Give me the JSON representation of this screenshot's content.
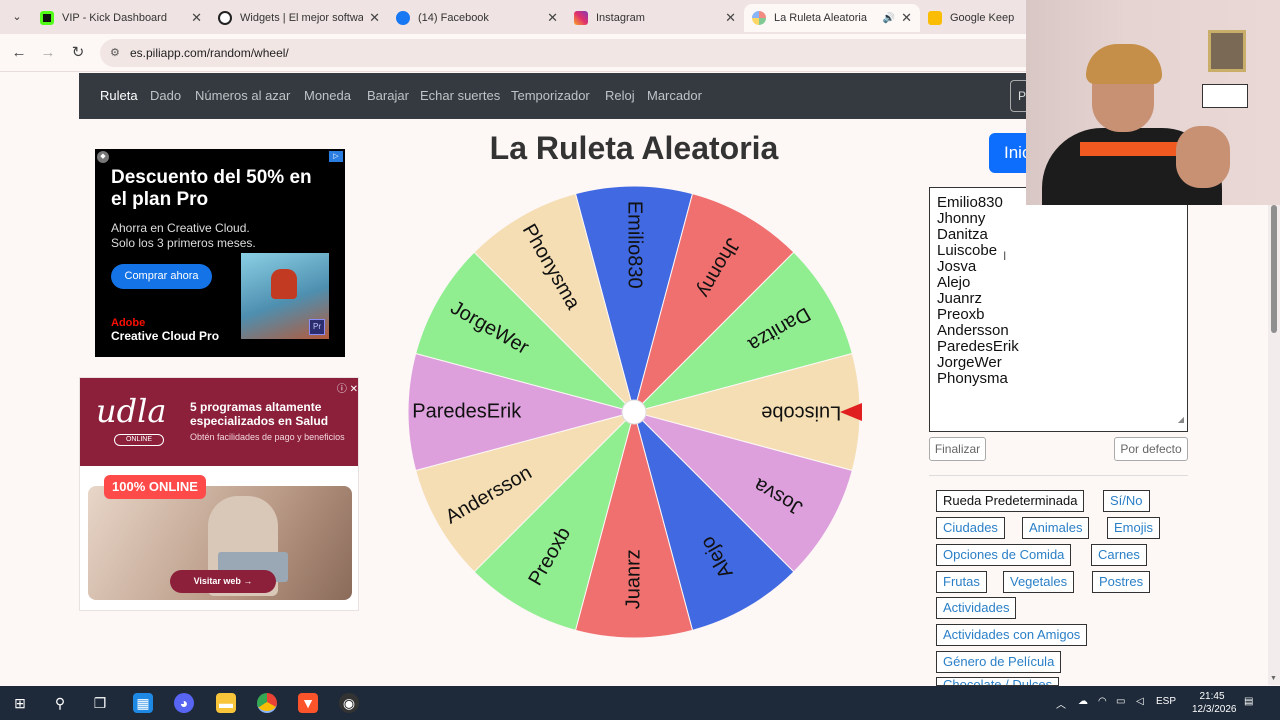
{
  "browser": {
    "tabs": [
      {
        "label": "VIP - Kick Dashboard",
        "color": "#53fc18"
      },
      {
        "label": "Widgets | El mejor software",
        "color": "#222222"
      },
      {
        "label": "(14) Facebook",
        "color": "#1877f2"
      },
      {
        "label": "Instagram",
        "color": "#e1306c"
      },
      {
        "label": "La Ruleta Aleatoria",
        "color": "#f28b82"
      },
      {
        "label": "Google Keep",
        "color": "#fbbc04"
      }
    ],
    "url": "es.piliapp.com/random/wheel/"
  },
  "nav": {
    "items": [
      "Ruleta",
      "Dado",
      "Números al azar",
      "Moneda",
      "Barajar",
      "Echar suertes",
      "Temporizador",
      "Reloj",
      "Marcador"
    ],
    "right_label": "Pa"
  },
  "ads": {
    "adobe": {
      "headline": "Descuento del 50% en el plan Pro",
      "subtext": "Ahorra en Creative Cloud. Solo los 3 primeros meses.",
      "cta": "Comprar ahora",
      "brand": "Adobe",
      "product": "Creative Cloud Pro",
      "badge": "Pr"
    },
    "udla": {
      "logo": "udla",
      "logo_sub": "ONLINE",
      "headline": "5 programas altamente especializados en Salud",
      "subtext": "Obtén facilidades de pago y beneficios",
      "badge": "100% ONLINE",
      "cta": "Visitar web →"
    }
  },
  "page": {
    "title": "La Ruleta Aleatoria",
    "start_label": "Inic"
  },
  "wheel": {
    "segments": [
      {
        "name": "Emilio830",
        "color": "#4169e1"
      },
      {
        "name": "Jhonny",
        "color": "#f07070"
      },
      {
        "name": "Danitza",
        "color": "#90ee90"
      },
      {
        "name": "Luiscobe",
        "color": "#f5deb3"
      },
      {
        "name": "Josva",
        "color": "#dda0dd"
      },
      {
        "name": "Alejo",
        "color": "#4169e1"
      },
      {
        "name": "Juanrz",
        "color": "#f07070"
      },
      {
        "name": "Preoxb",
        "color": "#90ee90"
      },
      {
        "name": "Andersson",
        "color": "#f5deb3"
      },
      {
        "name": "ParedesErik",
        "color": "#dda0dd"
      },
      {
        "name": "JorgeWer",
        "color": "#90ee90"
      },
      {
        "name": "Phonysma",
        "color": "#f5deb3"
      }
    ],
    "pointer_color": "#e02020"
  },
  "names": [
    "Emilio830",
    "Jhonny",
    "Danitza",
    "Luiscobe",
    "Josva",
    "Alejo",
    "Juanrz",
    "Preoxb",
    "Andersson",
    "ParedesErik",
    "JorgeWer",
    "Phonysma"
  ],
  "buttons": {
    "finish": "Finalizar",
    "default": "Por defecto"
  },
  "presets": [
    "Rueda Predeterminada",
    "Sí/No",
    "Ciudades",
    "Animales",
    "Emojis",
    "Opciones de Comida",
    "Carnes",
    "Frutas",
    "Vegetales",
    "Postres",
    "Actividades",
    "Actividades con Amigos",
    "Género de Película",
    "Chocolate / Dulces"
  ],
  "taskbar": {
    "language": "ESP",
    "time": "21:45",
    "date": "12/3/2026"
  }
}
